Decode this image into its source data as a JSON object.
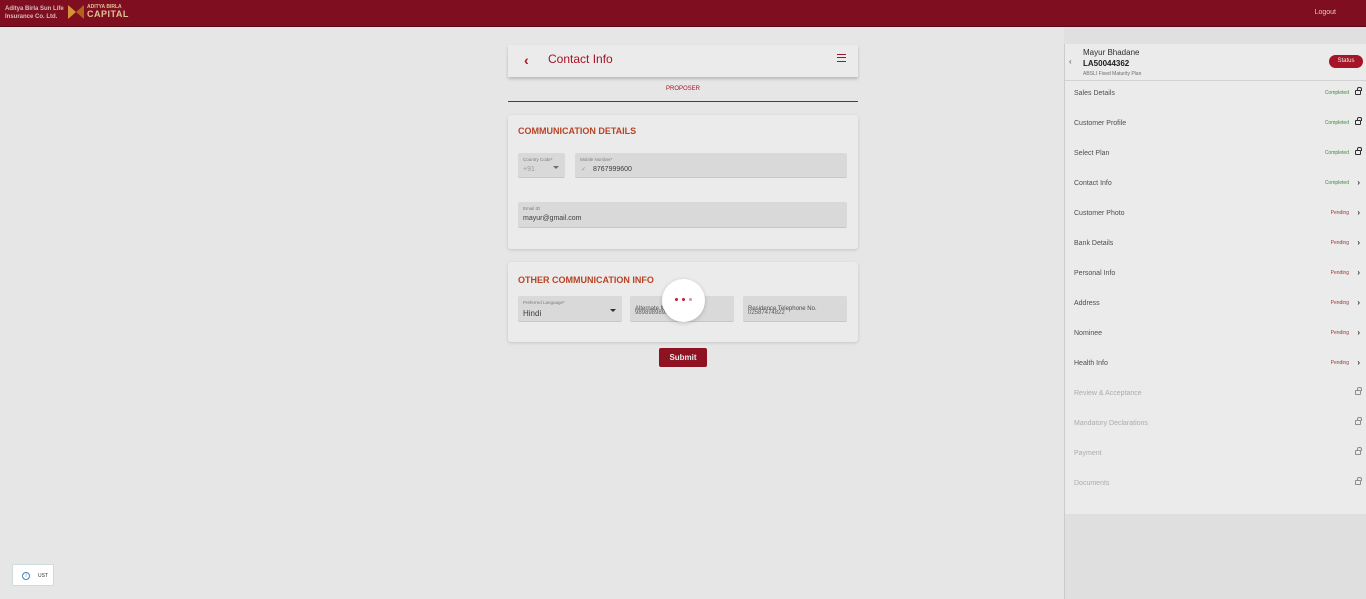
{
  "header": {
    "brand_life": "Aditya Birla Sun Life Insurance Co. Ltd.",
    "brand_capital_top": "ADITYA BIRLA",
    "brand_capital_main": "CAPITAL",
    "logout": "Logout"
  },
  "form": {
    "title": "Contact Info",
    "tab": "PROPOSER",
    "communication": {
      "title": "COMMUNICATION DETAILS",
      "country_code_label": "Country Code*",
      "country_code": "+91",
      "mobile_label": "Mobile Number*",
      "mobile": "8767999600",
      "email_label": "Email ID",
      "email": "mayur@gmail.com"
    },
    "other": {
      "title": "OTHER COMMUNICATION INFO",
      "language_label": "Preferred Language*",
      "language": "Hindi",
      "alternate_label": "Alternate Mobile No",
      "alternate": "9898989898",
      "residence_label": "Residence Telephone No.",
      "residence": "02587474822"
    },
    "submit": "Submit"
  },
  "sidebar": {
    "name": "Mayur Bhadane",
    "app_id": "LA50044362",
    "plan": "ABSLI Fixed Maturity Plan",
    "status_btn": "Status",
    "items": [
      {
        "label": "Sales Details",
        "status": "Completed",
        "icon": "lock-icon"
      },
      {
        "label": "Customer Profile",
        "status": "Completed",
        "icon": "lock-icon"
      },
      {
        "label": "Select Plan",
        "status": "Completed",
        "icon": "lock-icon"
      },
      {
        "label": "Contact Info",
        "status": "Completed",
        "icon": "chevron-right-icon"
      },
      {
        "label": "Customer Photo",
        "status": "Pending",
        "icon": "chevron-right-icon"
      },
      {
        "label": "Bank Details",
        "status": "Pending",
        "icon": "chevron-right-icon"
      },
      {
        "label": "Personal Info",
        "status": "Pending",
        "icon": "chevron-right-icon"
      },
      {
        "label": "Address",
        "status": "Pending",
        "icon": "chevron-right-icon"
      },
      {
        "label": "Nominee",
        "status": "Pending",
        "icon": "chevron-right-icon"
      },
      {
        "label": "Health Info",
        "status": "Pending",
        "icon": "chevron-right-icon"
      },
      {
        "label": "Review & Acceptance",
        "status": "",
        "icon": "lock-icon"
      },
      {
        "label": "Mandatory Declarations",
        "status": "",
        "icon": "lock-icon"
      },
      {
        "label": "Payment",
        "status": "",
        "icon": "lock-icon"
      },
      {
        "label": "Documents",
        "status": "",
        "icon": "lock-icon"
      }
    ]
  },
  "badge": {
    "text": "UST"
  },
  "colors": {
    "brand": "#8a1123",
    "accent": "#b3162b",
    "completed": "#3f9a4a",
    "pending": "#b03a3a"
  }
}
